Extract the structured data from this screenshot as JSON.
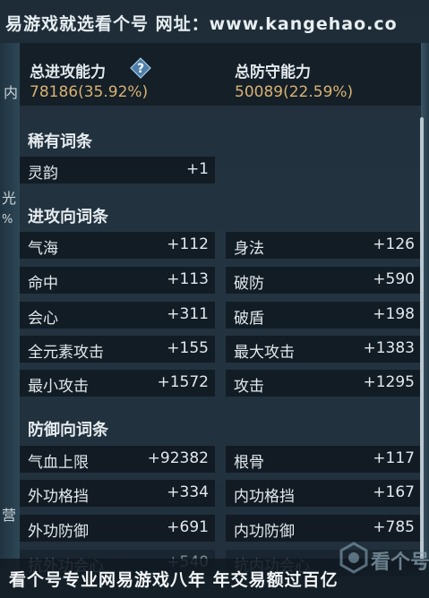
{
  "watermark": {
    "top": "易游戏就选看个号  网址：www.kangehao.co",
    "bottom": "看个号专业网易游戏八年  年交易额过百亿",
    "logo": "看个号"
  },
  "edge_glyphs": [
    "内",
    "光",
    "%",
    "营"
  ],
  "summary": {
    "attack": {
      "title": "总进攻能力",
      "value": "78186(35.92%)"
    },
    "defense": {
      "title": "总防守能力",
      "value": "50089(22.59%)"
    }
  },
  "sections": {
    "rare": {
      "title": "稀有词条",
      "rows": [
        {
          "name": "灵韵",
          "value": "+1"
        }
      ]
    },
    "offense": {
      "title": "进攻向词条",
      "rows": [
        {
          "name": "气海",
          "value": "+112"
        },
        {
          "name": "身法",
          "value": "+126"
        },
        {
          "name": "命中",
          "value": "+113"
        },
        {
          "name": "破防",
          "value": "+590"
        },
        {
          "name": "会心",
          "value": "+311"
        },
        {
          "name": "破盾",
          "value": "+198"
        },
        {
          "name": "全元素攻击",
          "value": "+155"
        },
        {
          "name": "最大攻击",
          "value": "+1383"
        },
        {
          "name": "最小攻击",
          "value": "+1572"
        },
        {
          "name": "攻击",
          "value": "+1295"
        }
      ]
    },
    "defense": {
      "title": "防御向词条",
      "rows": [
        {
          "name": "气血上限",
          "value": "+92382"
        },
        {
          "name": "根骨",
          "value": "+117"
        },
        {
          "name": "外功格挡",
          "value": "+334"
        },
        {
          "name": "内功格挡",
          "value": "+167"
        },
        {
          "name": "外功防御",
          "value": "+691"
        },
        {
          "name": "内功防御",
          "value": "+785"
        },
        {
          "name": "抗外功会心",
          "value": "+540"
        },
        {
          "name": "抗内功会心",
          "value": ""
        }
      ]
    }
  },
  "colors": {
    "accent_gold": "#d9b272",
    "row_bg": "#0e161e",
    "text": "#e2e8ec"
  }
}
